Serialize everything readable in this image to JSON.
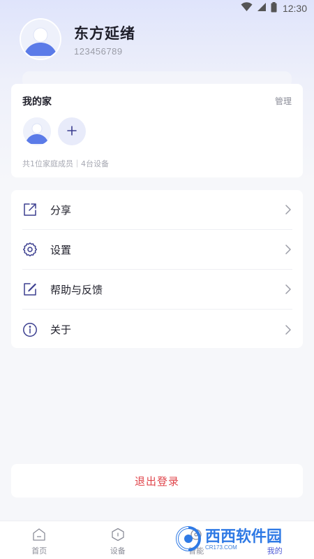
{
  "status_bar": {
    "time": "12:30",
    "icons": [
      "wifi-icon",
      "signal-icon",
      "battery-icon"
    ]
  },
  "profile": {
    "name": "东方延绪",
    "id": "123456789"
  },
  "family": {
    "title": "我的家",
    "manage_label": "管理",
    "summary": "共1位家庭成员｜4台设备"
  },
  "menu": [
    {
      "label": "分享",
      "icon": "share-icon"
    },
    {
      "label": "设置",
      "icon": "gear-icon"
    },
    {
      "label": "帮助与反馈",
      "icon": "edit-feedback-icon"
    },
    {
      "label": "关于",
      "icon": "info-icon"
    }
  ],
  "logout_label": "退出登录",
  "bottom_nav": [
    {
      "label": "首页",
      "icon": "home-icon",
      "active": false
    },
    {
      "label": "设备",
      "icon": "device-icon",
      "active": false
    },
    {
      "label": "智能",
      "icon": "smart-icon",
      "active": false
    },
    {
      "label": "我的",
      "icon": "profile-icon",
      "active": true
    }
  ],
  "watermark": {
    "text": "西西软件园",
    "sub": "CR173.COM"
  },
  "colors": {
    "accent": "#4f5bd5",
    "logout": "#e0454b",
    "background": "#f6f7fa",
    "icon": "#3b3e8f"
  }
}
